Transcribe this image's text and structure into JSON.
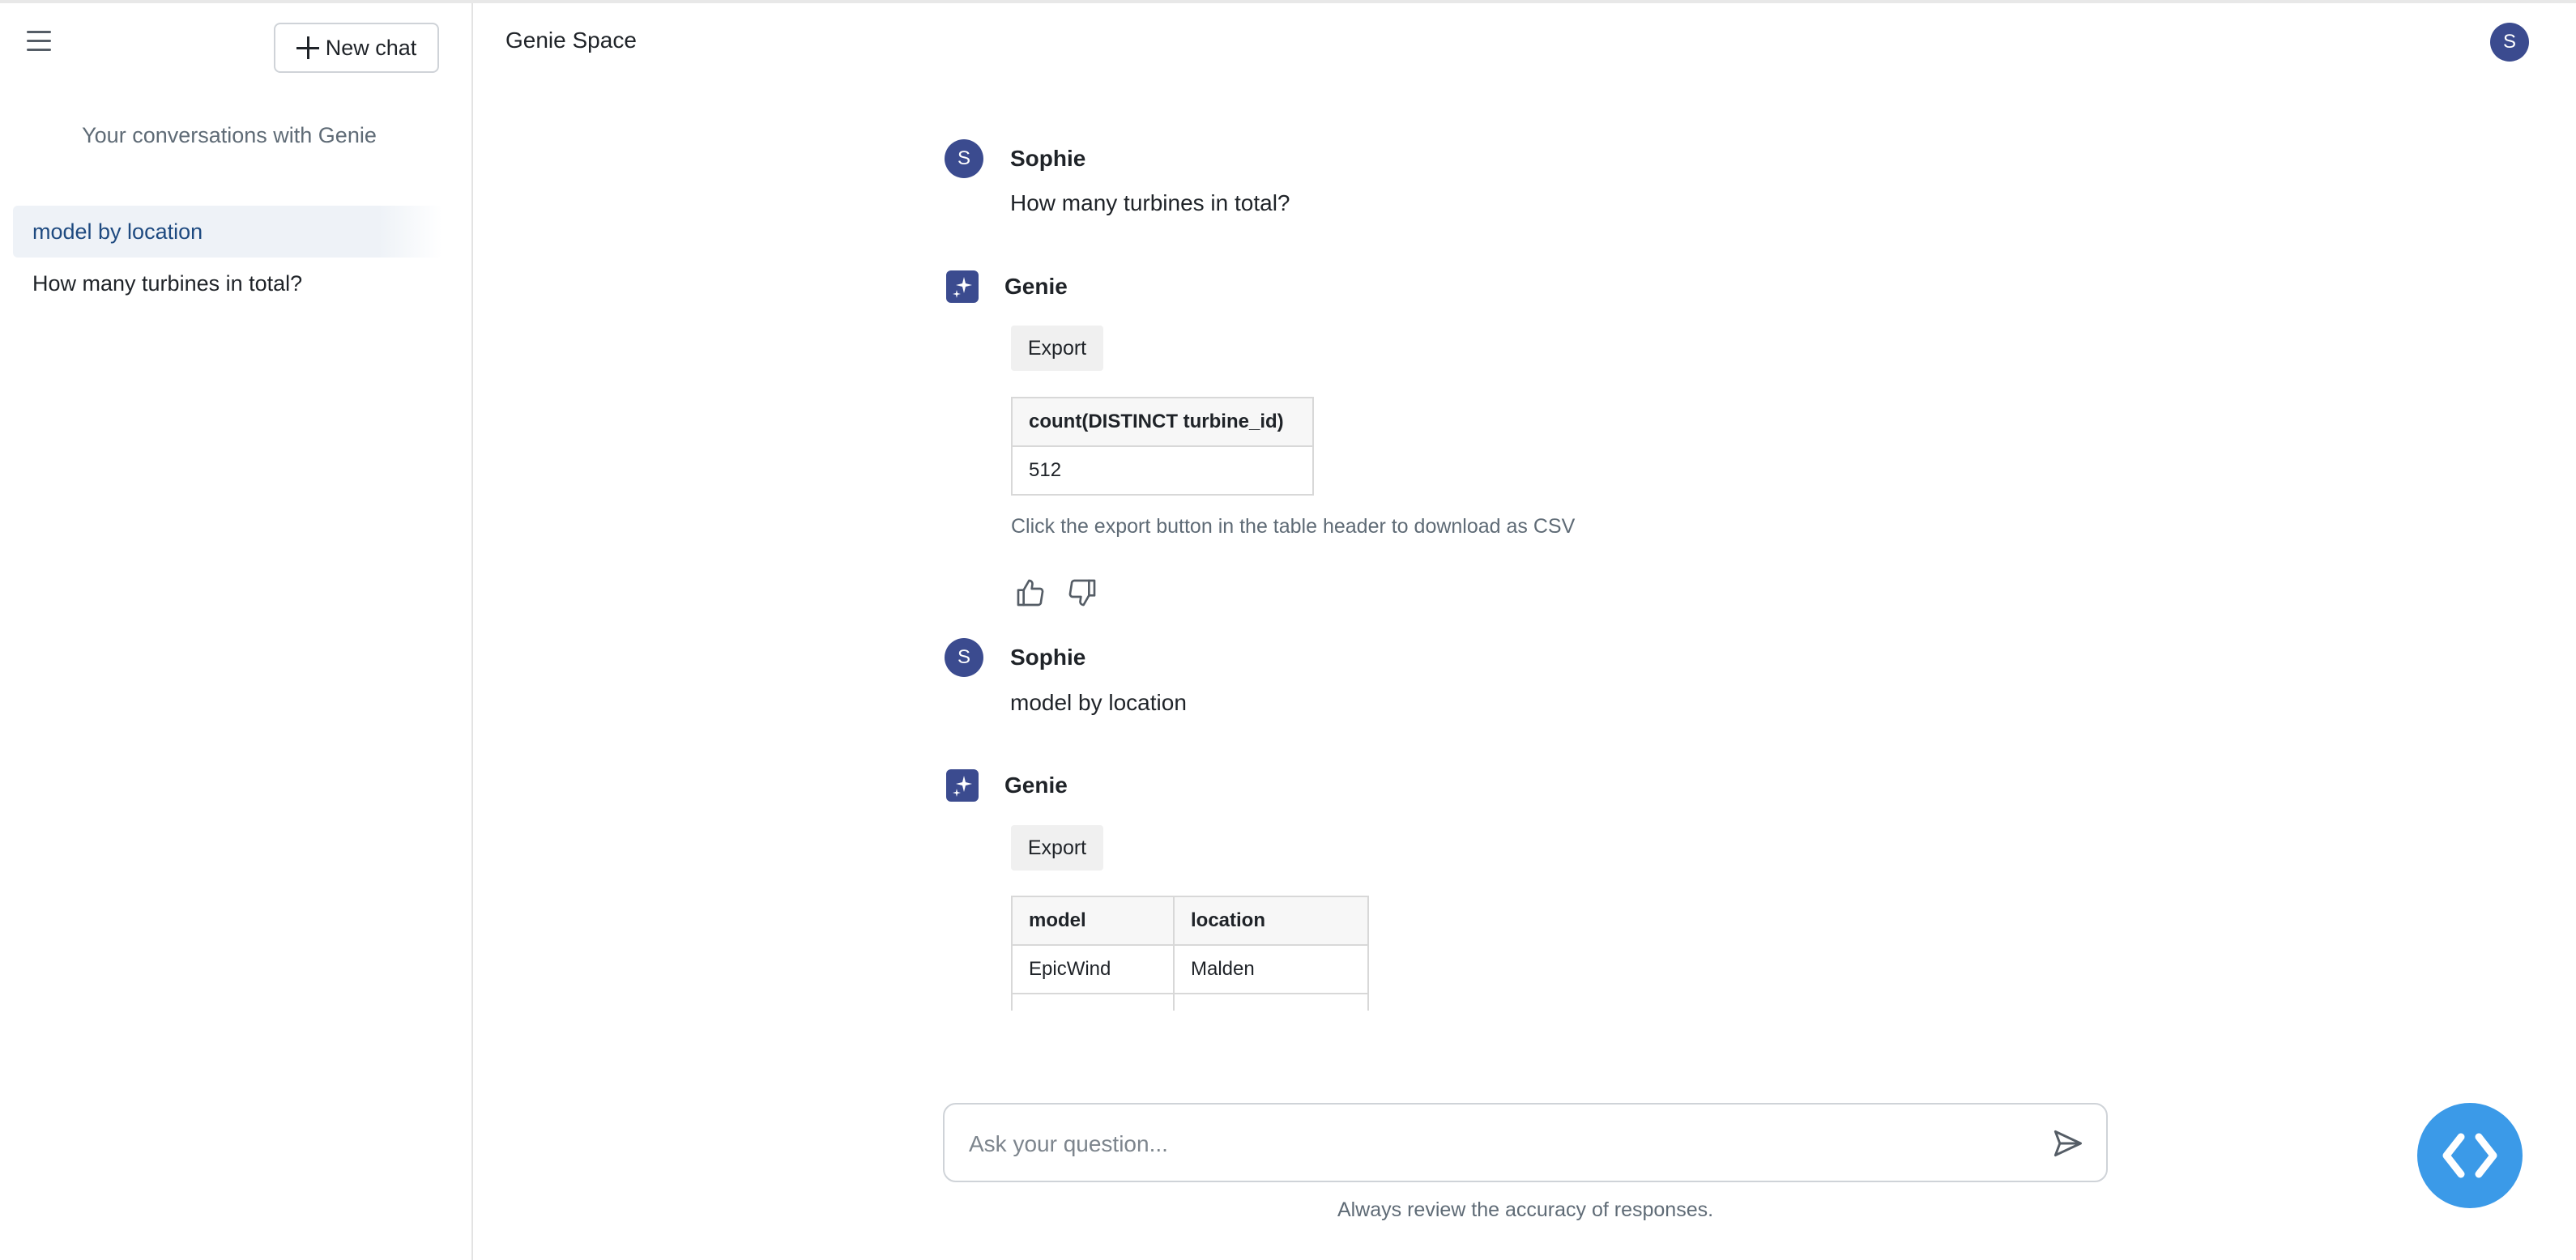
{
  "sidebar": {
    "new_chat_label": "New chat",
    "heading": "Your conversations with Genie",
    "conversations": [
      {
        "label": "model by location"
      },
      {
        "label": "How many turbines in total?"
      }
    ]
  },
  "header": {
    "title": "Genie Space",
    "user_initial": "S"
  },
  "messages": [
    {
      "author": "Sophie",
      "initial": "S",
      "text": "How many turbines in total?"
    },
    {
      "author": "Genie",
      "export_label": "Export",
      "table": {
        "columns": [
          "count(DISTINCT turbine_id)"
        ],
        "rows": [
          [
            "512"
          ]
        ]
      },
      "hint": "Click the export button in the table header to download as CSV"
    },
    {
      "author": "Sophie",
      "initial": "S",
      "text": "model by location"
    },
    {
      "author": "Genie",
      "export_label": "Export",
      "table": {
        "columns": [
          "model",
          "location"
        ],
        "rows": [
          [
            "EpicWind",
            "Malden"
          ]
        ]
      }
    }
  ],
  "input": {
    "placeholder": "Ask your question...",
    "value": ""
  },
  "disclaimer": "Always review the accuracy of responses.",
  "colors": {
    "accent": "#3b4b8f",
    "fab": "#3b9ae8",
    "active_conversation_text": "#1e4a80"
  },
  "icons": [
    "menu-icon",
    "plus-icon",
    "genie-sparkle-icon",
    "thumbs-up-icon",
    "thumbs-down-icon",
    "send-icon",
    "code-icon"
  ]
}
